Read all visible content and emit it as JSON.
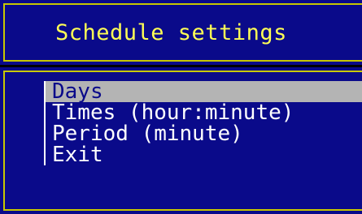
{
  "dialog": {
    "title": "Schedule settings"
  },
  "menu": {
    "items": [
      {
        "label": "Days",
        "selected": true
      },
      {
        "label": "Times (hour:minute)",
        "selected": false
      },
      {
        "label": "Period (minute)",
        "selected": false
      },
      {
        "label": "Exit",
        "selected": false
      }
    ]
  },
  "colors": {
    "background": "#0a0a8a",
    "border": "#c8c800",
    "title_text": "#ffff55",
    "menu_text": "#ffffff",
    "selection_bg": "#b4b4b4",
    "selection_text": "#0a0a8a"
  }
}
